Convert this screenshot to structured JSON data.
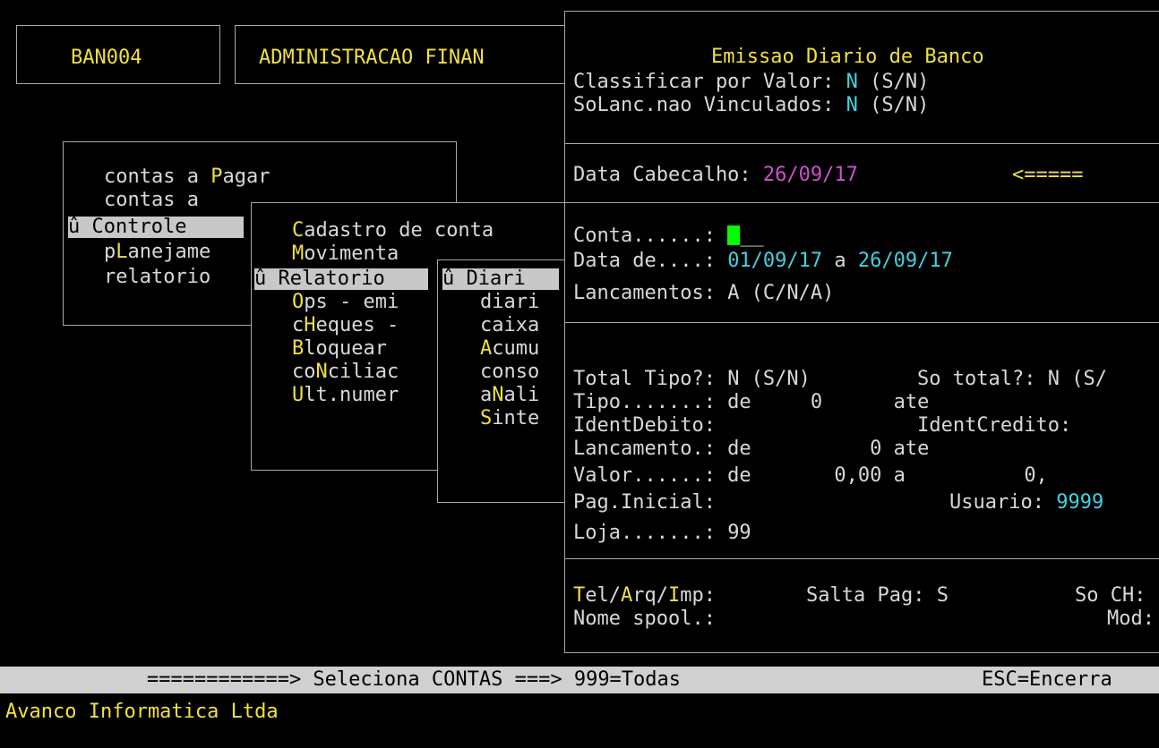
{
  "header": {
    "program_code": "BAN004",
    "app_title": "ADMINISTRACAO FINAN"
  },
  "main_menu": {
    "items": [
      {
        "prefix": "contas a ",
        "hotkey": "P",
        "suffix": "agar"
      },
      {
        "prefix": "contas a",
        "hotkey": "",
        "suffix": ""
      },
      {
        "marker": "û ",
        "prefix": "",
        "hotkey": "",
        "suffix": "Controle"
      },
      {
        "prefix": "p",
        "hotkey": "L",
        "suffix": "anejame"
      },
      {
        "prefix": "relatorio",
        "hotkey": "",
        "suffix": ""
      }
    ]
  },
  "sub_menu": {
    "items": [
      {
        "prefix": "",
        "hotkey": "C",
        "suffix": "adastro de conta"
      },
      {
        "prefix": "",
        "hotkey": "M",
        "suffix": "ovimenta"
      },
      {
        "marker": "û ",
        "prefix": "",
        "hotkey": "",
        "suffix": "Relatorio"
      },
      {
        "prefix": "",
        "hotkey": "O",
        "suffix": "ps - emi"
      },
      {
        "prefix": "c",
        "hotkey": "H",
        "suffix": "eques -"
      },
      {
        "prefix": "",
        "hotkey": "B",
        "suffix": "loquear"
      },
      {
        "prefix": "co",
        "hotkey": "N",
        "suffix": "ciliac"
      },
      {
        "prefix": "",
        "hotkey": "U",
        "suffix": "lt.numer"
      }
    ]
  },
  "report_menu": {
    "items": [
      {
        "marker": "û ",
        "prefix": "",
        "hotkey": "",
        "suffix": "Diari"
      },
      {
        "prefix": "diari",
        "hotkey": "",
        "suffix": ""
      },
      {
        "prefix": "caixa",
        "hotkey": "",
        "suffix": ""
      },
      {
        "prefix": "",
        "hotkey": "A",
        "suffix": "cumu"
      },
      {
        "prefix": "conso",
        "hotkey": "",
        "suffix": ""
      },
      {
        "prefix": "a",
        "hotkey": "N",
        "suffix": "ali"
      },
      {
        "prefix": "",
        "hotkey": "S",
        "suffix": "inte"
      }
    ]
  },
  "dialog": {
    "title": "Emissao Diario de Banco",
    "classificar_label": "Classificar por Valor: ",
    "classificar_value": "N",
    "classificar_hint": " (S/N)",
    "solanc_label": "SoLanc.nao Vinculados: ",
    "solanc_value": "N",
    "solanc_hint": " (S/N)",
    "data_cab_label": "Data Cabecalho: ",
    "data_cab_value": "26/09/17",
    "data_cab_arrow": "<=====",
    "conta_label": "Conta......: ",
    "conta_rest": "__",
    "data_de_label": "Data de....: ",
    "data_de_from": "01/09/17",
    "data_de_sep": " a ",
    "data_de_to": "26/09/17",
    "lanc_label": "Lancamentos: ",
    "lanc_value": "A",
    "lanc_hint": " (C/N/A)",
    "total_tipo_label": "Total Tipo?: ",
    "total_tipo_value": "N",
    "total_tipo_hint": " (S/N)",
    "so_total_label": "So total?: ",
    "so_total_value": "N",
    "so_total_hint": " (S/",
    "tipo_line": "Tipo.......: de     0      ate",
    "ident_line": "IdentDebito:                 IdentCredito:",
    "lancamento_line": "Lancamento.: de          0 ate",
    "valor_line": "Valor......: de       0,00 a          0,",
    "pag_label": "Pag.Inicial:",
    "usuario_label": "Usuario: ",
    "usuario_value": "9999",
    "loja_label": "Loja.......: ",
    "loja_value": "99",
    "tel_pre": "",
    "tel_h1": "T",
    "tel_mid1": "el/",
    "tel_h2": "A",
    "tel_mid2": "rq/",
    "tel_h3": "I",
    "tel_mid3": "mp:",
    "salta_label": "Salta Pag: ",
    "salta_value": "S",
    "so_ch_label": "So CH:",
    "spool_label": "Nome spool.:",
    "mod_label": "Mod:"
  },
  "status_bar": {
    "text": "============> Seleciona CONTAS ===> 999=Todas",
    "esc": "ESC=Encerra"
  },
  "footer": {
    "company": "Avanco Informatica Ltda"
  },
  "colors": {
    "hotkey": "#f0e040",
    "value": "#44d0e0",
    "date": "#d050d0",
    "cursor": "#00ff00"
  }
}
